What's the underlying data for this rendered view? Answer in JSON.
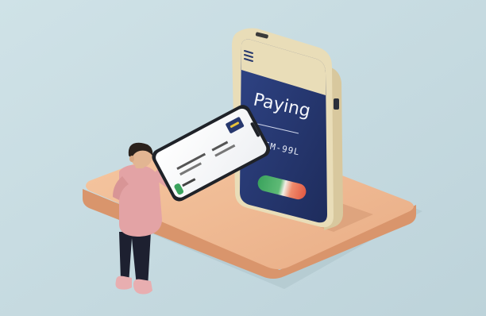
{
  "kiosk": {
    "title": "Paying",
    "code": "SM-99L"
  },
  "handheld": {
    "left_text": "",
    "right_text": "",
    "bottom_text": ""
  },
  "colors": {
    "background": "#c9dde3",
    "platform": "#efb992",
    "kiosk_body": "#27386e",
    "kiosk_frame": "#e9ddb8",
    "accept_green": "#3aa35d",
    "decline_red": "#e25a44",
    "shirt": "#e3a3a5",
    "pants": "#1d2030",
    "hair": "#2a211c"
  }
}
